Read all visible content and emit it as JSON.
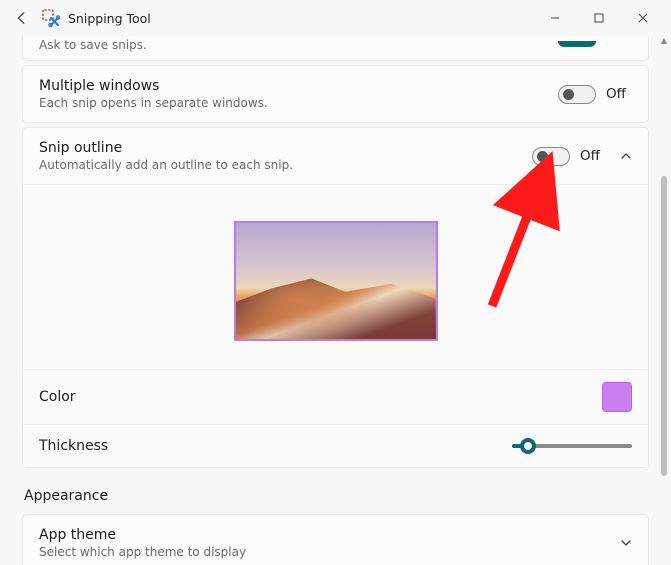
{
  "window": {
    "title": "Snipping Tool"
  },
  "partial": {
    "subtitle": "Ask to save snips."
  },
  "settings": {
    "multiple_windows": {
      "title": "Multiple windows",
      "subtitle": "Each snip opens in separate windows.",
      "state_label": "Off",
      "on": false
    },
    "snip_outline": {
      "title": "Snip outline",
      "subtitle": "Automatically add an outline to each snip.",
      "state_label": "Off",
      "on": false,
      "expanded": true,
      "color_label": "Color",
      "color_value": "#c97ff0",
      "thickness_label": "Thickness",
      "thickness_value": 1
    }
  },
  "appearance": {
    "header": "Appearance",
    "app_theme": {
      "title": "App theme",
      "subtitle": "Select which app theme to display"
    }
  }
}
